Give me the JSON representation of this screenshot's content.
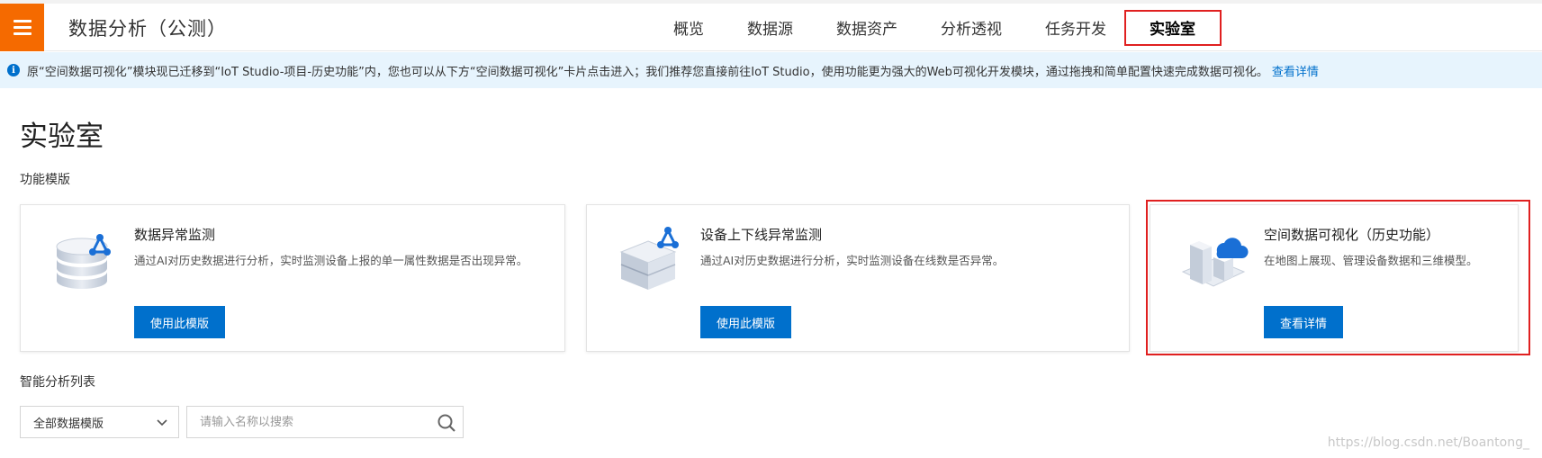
{
  "app": {
    "title": "数据分析（公测）",
    "menu_icon": "hamburger-menu-icon"
  },
  "nav": {
    "items": [
      {
        "label": "概览",
        "active": false
      },
      {
        "label": "数据源",
        "active": false
      },
      {
        "label": "数据资产",
        "active": false
      },
      {
        "label": "分析透视",
        "active": false
      },
      {
        "label": "任务开发",
        "active": false
      },
      {
        "label": "实验室",
        "active": true
      }
    ]
  },
  "notice": {
    "icon": "info-icon",
    "text": "原“空间数据可视化”模块现已迁移到“IoT Studio-项目-历史功能”内，您也可以从下方“空间数据可视化”卡片点击进入；我们推荐您直接前往IoT Studio，使用功能更为强大的Web可视化开发模块，通过拖拽和简单配置快速完成数据可视化。",
    "link": "查看详情"
  },
  "page": {
    "title": "实验室",
    "templates_label": "功能模版",
    "list_label": "智能分析列表"
  },
  "cards": [
    {
      "title": "数据异常监测",
      "desc": "通过AI对历史数据进行分析，实时监测设备上报的单一属性数据是否出现异常。",
      "button": "使用此模版",
      "icon": "database-ai-icon"
    },
    {
      "title": "设备上下线异常监测",
      "desc": "通过AI对历史数据进行分析，实时监测设备在线数是否异常。",
      "button": "使用此模版",
      "icon": "device-box-ai-icon"
    },
    {
      "title": "空间数据可视化（历史功能）",
      "desc": "在地图上展现、管理设备数据和三维模型。",
      "button": "查看详情",
      "icon": "building-cloud-icon"
    }
  ],
  "filter": {
    "select_value": "全部数据模版",
    "search_placeholder": "请输入名称以搜索"
  },
  "watermark": "https://blog.csdn.net/Boantong_",
  "colors": {
    "accent": "#0070cc",
    "brand_orange": "#f56a00",
    "notice_bg": "#e7f4fd",
    "highlight_red": "#e02020"
  }
}
